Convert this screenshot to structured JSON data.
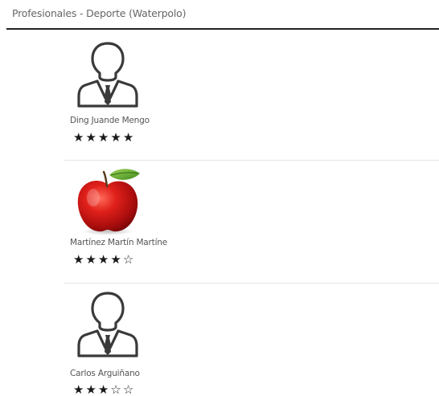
{
  "header": {
    "title": "Profesionales - Deporte (Waterpolo)"
  },
  "professionals": [
    {
      "name": "Ding Juande Mengo",
      "avatar": "person-silhouette-icon",
      "rating": 5,
      "max_rating": 5
    },
    {
      "name": "Martínez Martín Martíne",
      "avatar": "apple-photo",
      "rating": 4,
      "max_rating": 5
    },
    {
      "name": "Carlos Arguiñano",
      "avatar": "person-silhouette-icon",
      "rating": 3,
      "max_rating": 5
    }
  ],
  "colors": {
    "star": "#1a1a1a",
    "divider": "#e5e5e5",
    "header_rule": "#222222"
  }
}
